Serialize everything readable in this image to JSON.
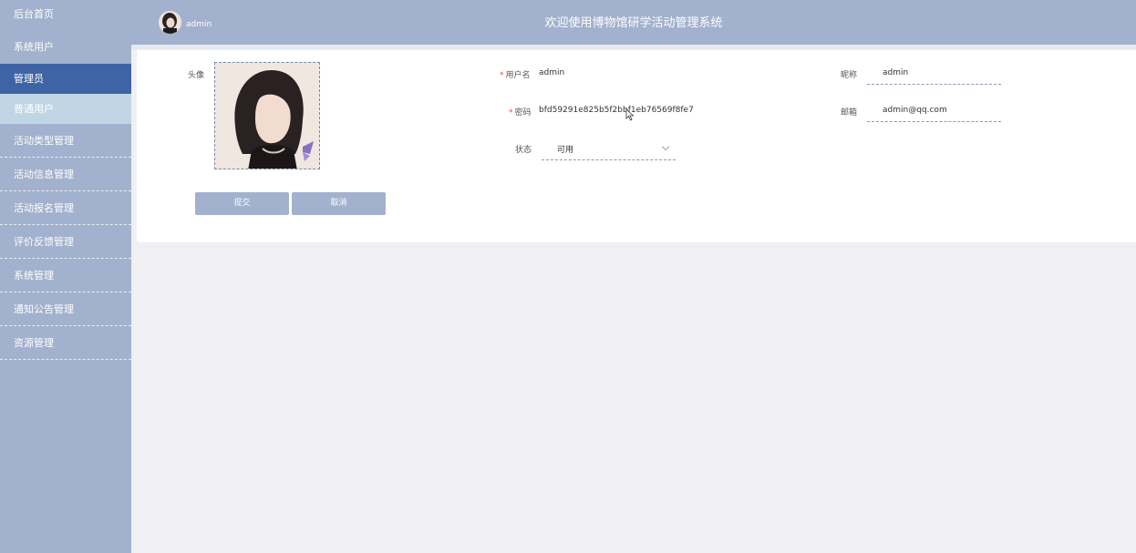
{
  "sidebar": {
    "items": [
      {
        "label": "后台首页"
      },
      {
        "label": "系统用户"
      },
      {
        "label": "管理员"
      },
      {
        "label": "普通用户"
      },
      {
        "label": "活动类型管理"
      },
      {
        "label": "活动信息管理"
      },
      {
        "label": "活动报名管理"
      },
      {
        "label": "评价反馈管理"
      },
      {
        "label": "系统管理"
      },
      {
        "label": "通知公告管理"
      },
      {
        "label": "资源管理"
      }
    ]
  },
  "header": {
    "username": "admin",
    "title": "欢迎使用博物馆研学活动管理系统"
  },
  "form": {
    "avatar_label": "头像",
    "username_label": "用户名",
    "username_value": "admin",
    "nickname_label": "昵称",
    "nickname_value": "admin",
    "password_label": "密码",
    "password_value": "bfd59291e825b5f2bbf1eb76569f8fe7",
    "email_label": "邮箱",
    "email_value": "admin@qq.com",
    "status_label": "状态",
    "status_value": "可用",
    "required_mark": "*",
    "submit_label": "提交",
    "cancel_label": "取消"
  },
  "colors": {
    "sidebar_bg": "#a2b1cd",
    "active_item": "#3f64a5",
    "sub_item": "#c0d6e5",
    "required": "#e2552f"
  }
}
